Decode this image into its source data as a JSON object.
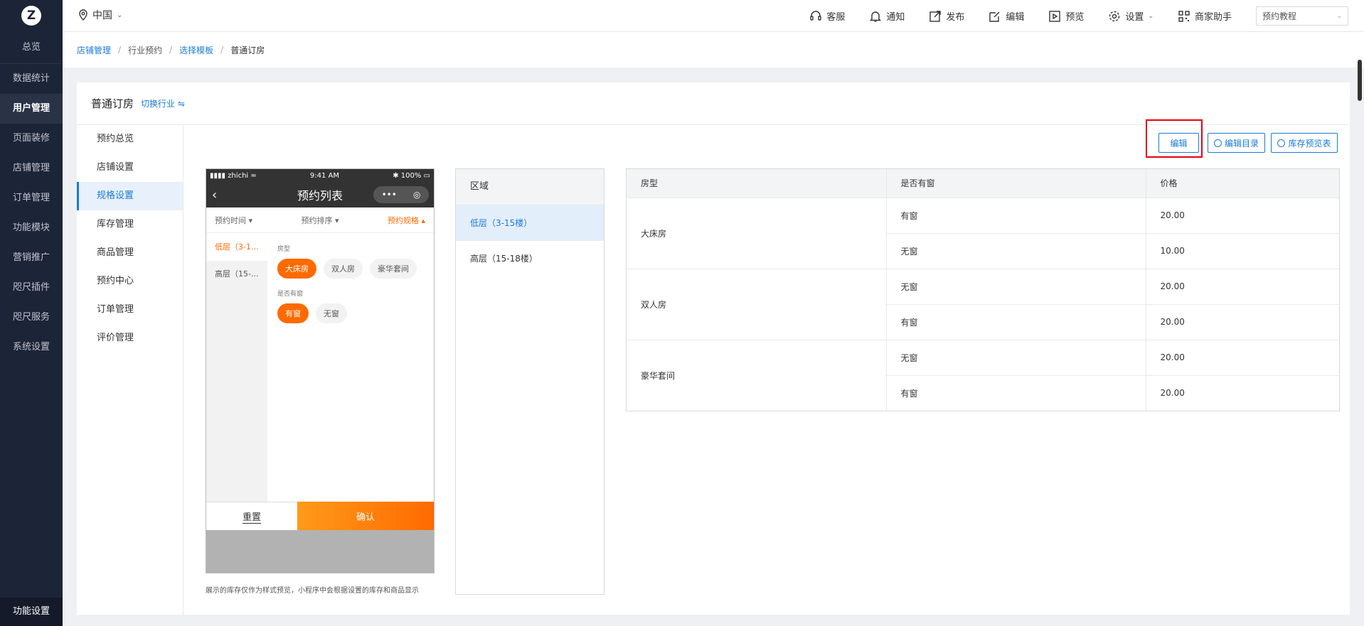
{
  "sidebar": {
    "logo": "Z",
    "overview": "总览",
    "items": [
      {
        "label": "数据统计"
      },
      {
        "label": "用户管理"
      },
      {
        "label": "页面装修"
      },
      {
        "label": "店铺管理"
      },
      {
        "label": "订单管理"
      },
      {
        "label": "功能模块"
      },
      {
        "label": "营销推广"
      },
      {
        "label": "咫尺插件"
      },
      {
        "label": "咫尺服务"
      },
      {
        "label": "系统设置"
      }
    ],
    "bottom": "功能设置"
  },
  "topbar": {
    "region": "中国",
    "tools": [
      {
        "label": "客服"
      },
      {
        "label": "通知"
      },
      {
        "label": "发布"
      },
      {
        "label": "编辑"
      },
      {
        "label": "预览"
      },
      {
        "label": "设置"
      },
      {
        "label": "商家助手"
      }
    ],
    "tutorial": "预约教程"
  },
  "breadcrumb": [
    "店铺管理",
    "行业预约",
    "选择模板",
    "普通订房"
  ],
  "panel": {
    "title": "普通订房",
    "switch": "切换行业 ⇋"
  },
  "subnav": [
    {
      "label": "预约总览"
    },
    {
      "label": "店铺设置"
    },
    {
      "label": "规格设置"
    },
    {
      "label": "库存管理"
    },
    {
      "label": "商品管理"
    },
    {
      "label": "预约中心"
    },
    {
      "label": "订单管理"
    },
    {
      "label": "评价管理"
    }
  ],
  "actions": {
    "edit": "编辑",
    "edit_catalog": "编辑目录",
    "stock_preview": "库存预览表"
  },
  "phone": {
    "carrier": "zhichi",
    "time": "9:41 AM",
    "battery": "100%",
    "title": "预约列表",
    "filters": [
      "预约时间",
      "预约排序",
      "预约规格"
    ],
    "floors": [
      "低层（3-1...",
      "高层（15-..."
    ],
    "room_type_label": "房型",
    "room_types": [
      "大床房",
      "双人房",
      "豪华套间"
    ],
    "window_label": "是否有窗",
    "window_options": [
      "有窗",
      "无窗"
    ],
    "reset": "重置",
    "confirm": "确认"
  },
  "preview_note": "展示的库存仅作为样式预览，小程序中会根据设置的库存和商品显示",
  "areas": {
    "header": "区域",
    "rows": [
      "低层（3-15楼）",
      "高层（15-18楼）"
    ]
  },
  "price_table": {
    "headers": [
      "房型",
      "是否有窗",
      "价格"
    ],
    "groups": [
      {
        "room": "大床房",
        "rows": [
          {
            "window": "有窗",
            "price": "20.00"
          },
          {
            "window": "无窗",
            "price": "10.00"
          }
        ]
      },
      {
        "room": "双人房",
        "rows": [
          {
            "window": "无窗",
            "price": "20.00"
          },
          {
            "window": "有窗",
            "price": "20.00"
          }
        ]
      },
      {
        "room": "豪华套间",
        "rows": [
          {
            "window": "无窗",
            "price": "20.00"
          },
          {
            "window": "有窗",
            "price": "20.00"
          }
        ]
      }
    ]
  },
  "colors": {
    "sidebar_bg": "#1c2438",
    "accent_blue": "#1a7ad8",
    "accent_orange": "#ff6a00",
    "highlight_red": "#e60012"
  }
}
